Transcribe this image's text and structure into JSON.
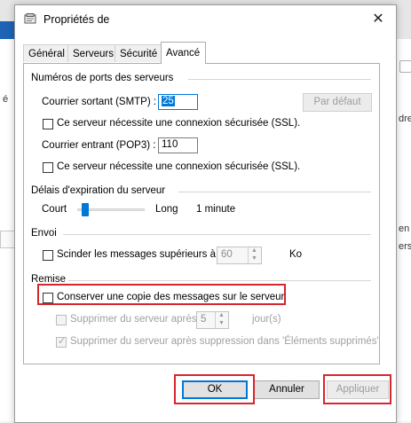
{
  "background": {
    "left_fragment": "é",
    "right_fragments": [
      "dre",
      "en",
      "ersat"
    ]
  },
  "dialog": {
    "title": "Propriétés de",
    "close_glyph": "✕",
    "tabs": [
      "Général",
      "Serveurs",
      "Sécurité",
      "Avancé"
    ],
    "active_tab": "Avancé",
    "ports": {
      "group_title": "Numéros de ports des serveurs",
      "smtp_label": "Courrier sortant (SMTP) :",
      "smtp_value": "25",
      "default_button": "Par défaut",
      "smtp_ssl_label": "Ce serveur nécessite une connexion sécurisée (SSL).",
      "pop3_label": "Courrier entrant (POP3) :",
      "pop3_value": "110",
      "pop3_ssl_label": "Ce serveur nécessite une connexion sécurisée (SSL)."
    },
    "timeout": {
      "group_title": "Délais d'expiration du serveur",
      "short_label": "Court",
      "long_label": "Long",
      "value": "1 minute",
      "slider_level": 0.08
    },
    "send": {
      "group_title": "Envoi",
      "split_label": "Scinder les messages supérieurs à",
      "split_value": "60",
      "unit": "Ko"
    },
    "delivery": {
      "group_title": "Remise",
      "keep_copy_label": "Conserver une copie des messages sur le serveur",
      "remove_after_label": "Supprimer du serveur après",
      "remove_after_value": "5",
      "days_label": "jour(s)",
      "remove_deleted_label": "Supprimer du serveur après suppression dans 'Éléments supprimés'"
    },
    "buttons": {
      "ok": "OK",
      "cancel": "Annuler",
      "apply": "Appliquer"
    },
    "highlight_color": "#d6262e",
    "accent_color": "#0078d7"
  }
}
